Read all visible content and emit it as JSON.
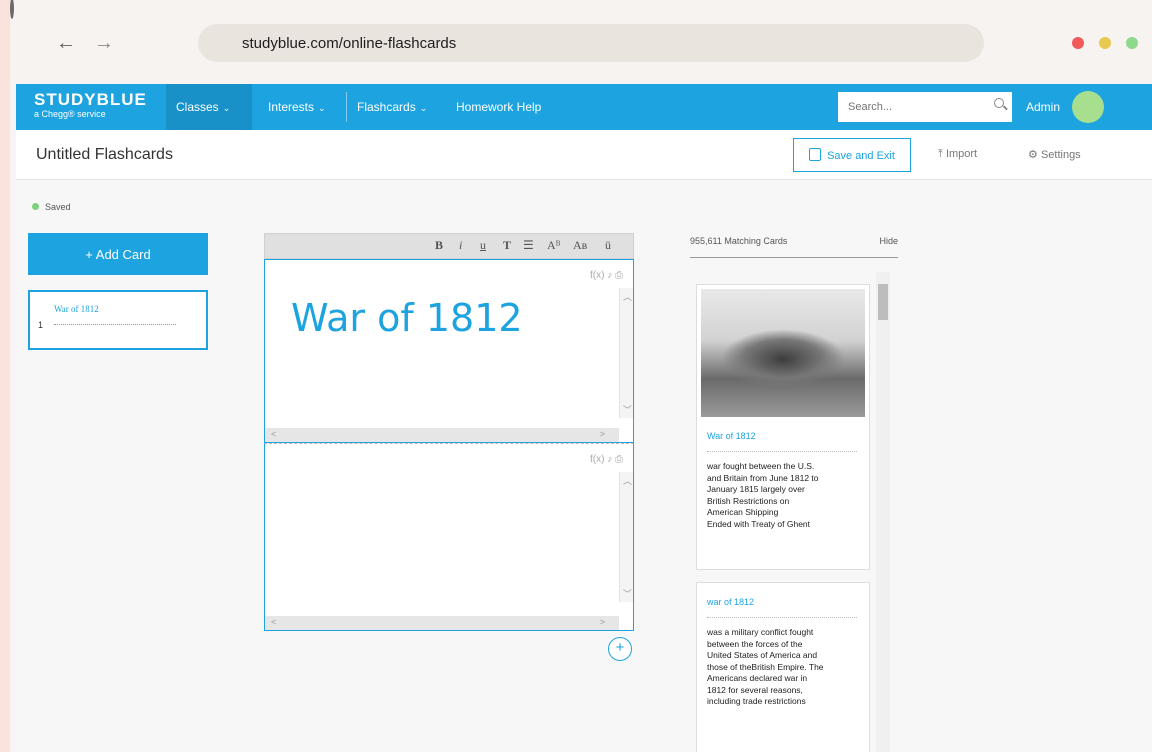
{
  "browser": {
    "url": "studyblue.com/online-flashcards",
    "back_icon": "←",
    "forward_icon": "→",
    "window_controls": {
      "red": "#f2595b",
      "yellow": "#e6c94e",
      "green": "#8ed98b"
    }
  },
  "header": {
    "logo_main": "STUDYBLUE",
    "logo_sub": "a Chegg® service",
    "nav": {
      "classes": "Classes",
      "interests": "Interests",
      "flashcards": "Flashcards",
      "homework": "Homework Help"
    },
    "caret": "⌄",
    "search_placeholder": "Search...",
    "admin": "Admin",
    "brand_color": "#1da3df"
  },
  "toolbar": {
    "title": "Untitled Flashcards",
    "save_exit": "Save and Exit",
    "import": "Import",
    "import_icon": "⤒",
    "settings": "Settings",
    "settings_icon": "⚙"
  },
  "sidebar": {
    "status": "Saved",
    "add_card": "+ Add Card",
    "cards": [
      {
        "num": "1",
        "title": "War of 1812"
      }
    ]
  },
  "editor": {
    "format_buttons": [
      "B",
      "i",
      "u",
      "T",
      "☰",
      "Aᴮ",
      "Aʙ",
      "ü"
    ],
    "face_tools": "f(x)  ♪  ⎙",
    "front_text": "War of 1812",
    "back_text": "",
    "plus": "+"
  },
  "matches": {
    "count_label": "955,611 Matching Cards",
    "hide": "Hide",
    "cards": [
      {
        "title": "War of 1812",
        "body": "war fought between the U.S.\nand Britain from June 1812 to\nJanuary 1815 largely over\nBritish Restrictions on\nAmerican Shipping\nEnded with Treaty of Ghent"
      },
      {
        "title": "war of 1812",
        "body": "was a military conflict fought\nbetween the forces of the\nUnited States of America and\nthose of theBritish Empire. The\nAmericans declared war in\n1812 for several reasons,\nincluding trade restrictions"
      }
    ]
  }
}
